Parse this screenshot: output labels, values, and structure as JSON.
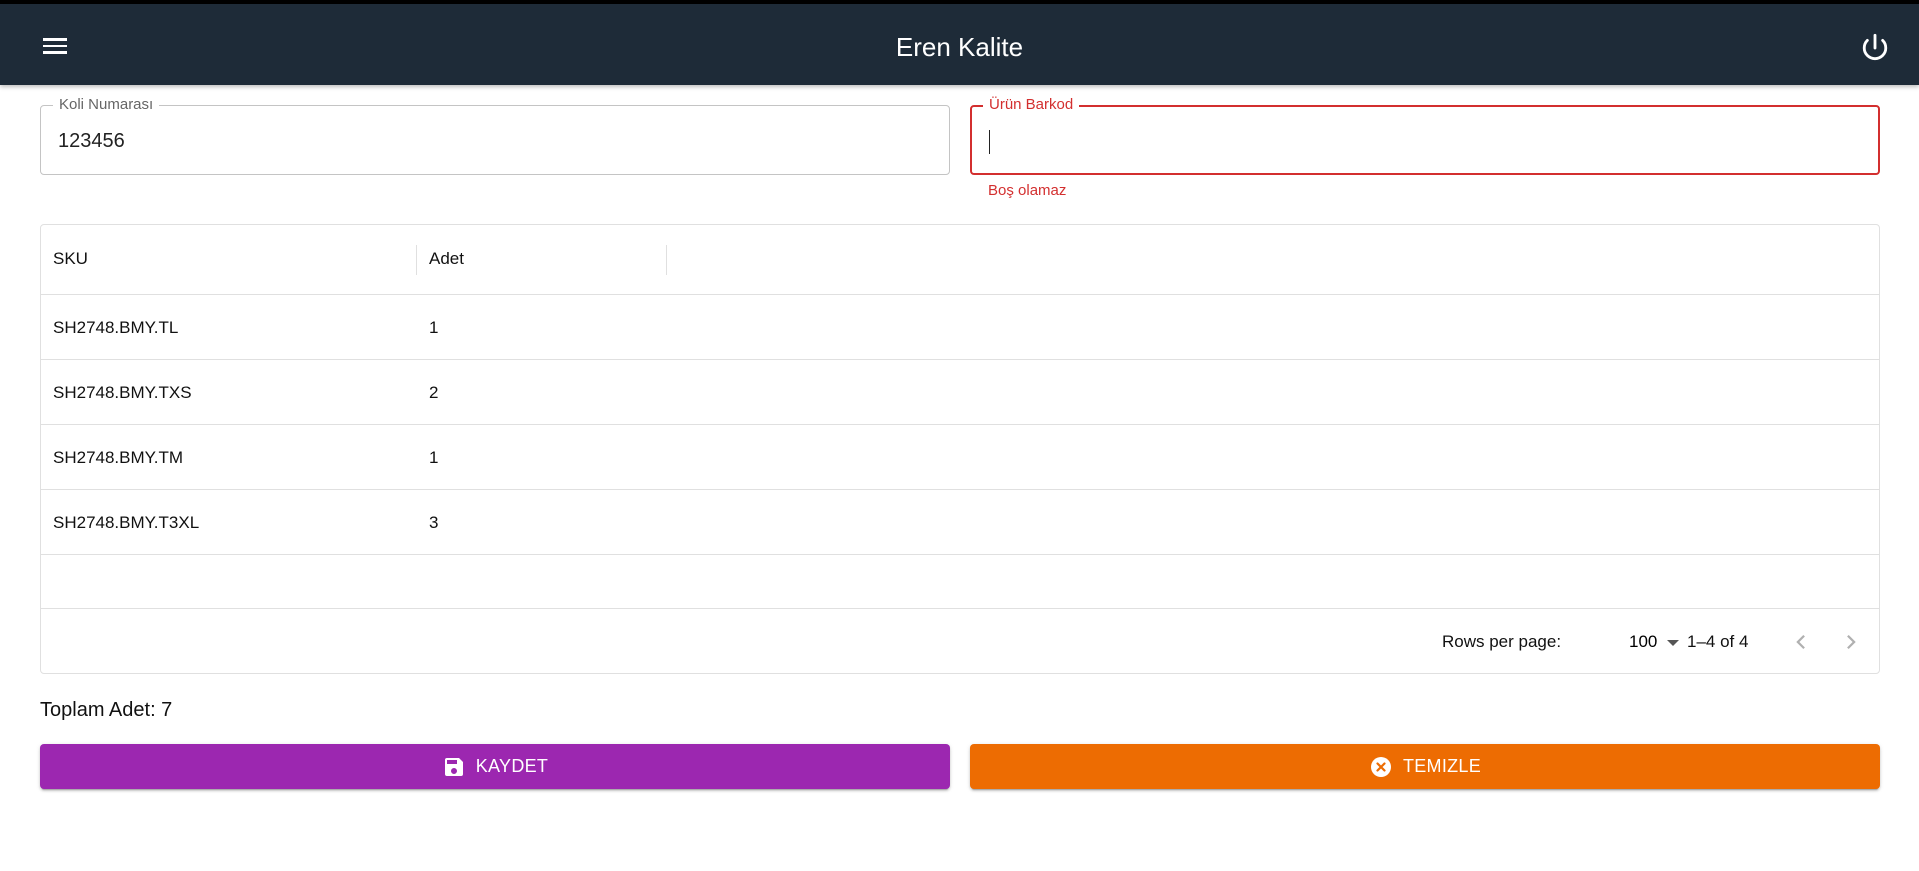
{
  "app": {
    "title": "Eren Kalite"
  },
  "form": {
    "koli": {
      "label": "Koli Numarası",
      "value": "123456"
    },
    "barkod": {
      "label": "Ürün Barkod",
      "value": "",
      "error": "Boş olamaz"
    }
  },
  "table": {
    "columns": [
      "SKU",
      "Adet"
    ],
    "rows": [
      {
        "sku": "SH2748.BMY.TL",
        "adet": "1"
      },
      {
        "sku": "SH2748.BMY.TXS",
        "adet": "2"
      },
      {
        "sku": "SH2748.BMY.TM",
        "adet": "1"
      },
      {
        "sku": "SH2748.BMY.T3XL",
        "adet": "3"
      }
    ],
    "footer": {
      "rows_per_page_label": "Rows per page:",
      "rows_per_page_value": "100",
      "range": "1–4 of 4"
    }
  },
  "total": {
    "label": "Toplam Adet: 7"
  },
  "actions": {
    "save_label": "KAYDET",
    "clear_label": "TEMIZLE"
  },
  "colors": {
    "appbar": "#1e2b38",
    "save": "#9c27b0",
    "clear": "#ed6c02",
    "error": "#d32f2f"
  },
  "icons": {
    "menu": "menu-icon",
    "power": "power-icon",
    "save": "save-icon",
    "clear": "clear-circle-icon",
    "prev": "chevron-left-icon",
    "next": "chevron-right-icon"
  }
}
